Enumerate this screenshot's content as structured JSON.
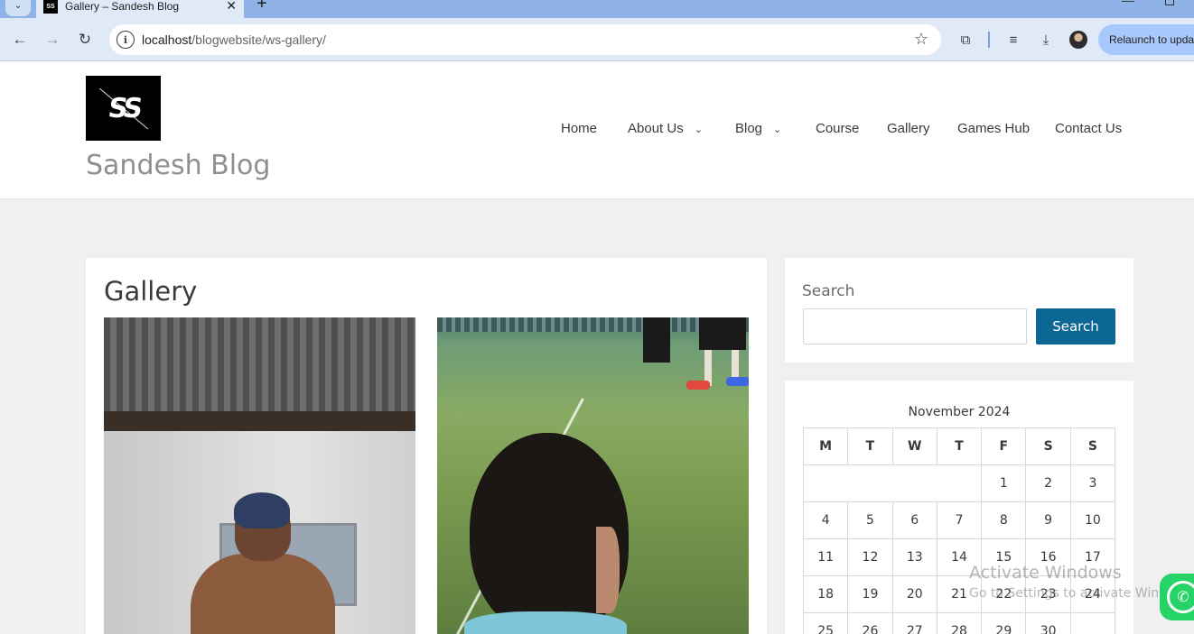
{
  "browser": {
    "tab_title": "Gallery – Sandesh Blog",
    "url_host": "localhost",
    "url_path": "/blogwebsite/ws-gallery/",
    "relaunch_label": "Relaunch to update"
  },
  "site": {
    "logo_text": "SS",
    "title": "Sandesh Blog",
    "nav": [
      {
        "label": "Home"
      },
      {
        "label": "About Us"
      },
      {
        "label": "Blog"
      },
      {
        "label": "Course"
      },
      {
        "label": "Gallery"
      },
      {
        "label": "Games Hub"
      },
      {
        "label": "Contact Us"
      }
    ]
  },
  "page": {
    "title": "Gallery"
  },
  "sidebar": {
    "search": {
      "label": "Search",
      "value": "",
      "button_label": "Search"
    },
    "calendar": {
      "caption": "November 2024",
      "weekdays": [
        "M",
        "T",
        "W",
        "T",
        "F",
        "S",
        "S"
      ],
      "weeks": [
        [
          "",
          "",
          "",
          "",
          "1",
          "2",
          "3"
        ],
        [
          "4",
          "5",
          "6",
          "7",
          "8",
          "9",
          "10"
        ],
        [
          "11",
          "12",
          "13",
          "14",
          "15",
          "16",
          "17"
        ],
        [
          "18",
          "19",
          "20",
          "21",
          "22",
          "23",
          "24"
        ],
        [
          "25",
          "26",
          "27",
          "28",
          "29",
          "30",
          ""
        ]
      ]
    }
  },
  "overlay": {
    "activate_title": "Activate Windows",
    "activate_sub": "Go to Settings to activate Windows."
  }
}
